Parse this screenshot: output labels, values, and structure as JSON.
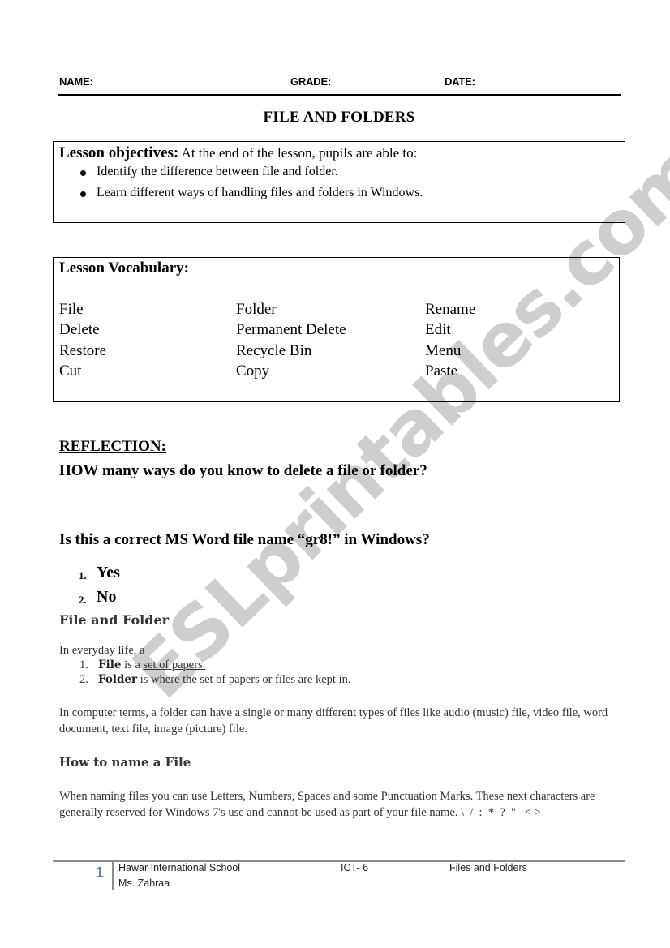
{
  "header": {
    "name_label": "NAME:",
    "grade_label": "GRADE:",
    "date_label": "DATE:",
    "title": "FILE AND FOLDERS"
  },
  "objectives": {
    "heading": "Lesson objectives:",
    "intro": "At the end of the lesson, pupils are able to:",
    "items": [
      "Identify the difference between file and folder.",
      "Learn different ways of handling files and folders in Windows."
    ]
  },
  "vocabulary": {
    "heading": "Lesson Vocabulary:",
    "rows": [
      [
        "File",
        "Folder",
        "Rename"
      ],
      [
        "Delete",
        "Permanent Delete",
        "Edit"
      ],
      [
        "Restore",
        "Recycle Bin",
        "Menu"
      ],
      [
        "Cut",
        "Copy",
        "Paste"
      ]
    ]
  },
  "reflection": {
    "heading": "REFLECTION:",
    "question1": "HOW many ways do you know to delete a file or folder?",
    "question2": "Is this a correct MS Word file name “gr8!” in Windows?",
    "answers": [
      {
        "num": "1.",
        "label": "Yes"
      },
      {
        "num": "2.",
        "label": "No"
      }
    ]
  },
  "file_and_folder": {
    "heading": "File and Folder",
    "intro": "In everyday life, a",
    "items": [
      {
        "num": "1.",
        "term": "File",
        "connector": " is a ",
        "definition": "set of papers."
      },
      {
        "num": "2.",
        "term": "Folder",
        "connector": " is ",
        "definition": "where the set of papers or files are kept in."
      }
    ],
    "computer_terms": "In computer terms, a folder can have a single or many different types of files like audio (music) file, video file, word document, text file, image (picture) file."
  },
  "naming": {
    "heading": "How to name a File",
    "text": "When naming files you can use Letters, Numbers, Spaces and some Punctuation Marks. These next characters are generally reserved for Windows 7's use and cannot be used as part of your file name. \\  /  :  *  ?  \"   < >  |"
  },
  "footer": {
    "page_number": "1",
    "school": "Hawar International School",
    "teacher": "Ms. Zahraa",
    "course": "ICT- 6",
    "topic": "Files and Folders"
  },
  "watermark": "ESLprintables.com",
  "colors": {
    "page_number": "#5b7a96",
    "watermark": "#c8c8c8",
    "footer_rule": "#8c8c8c"
  }
}
